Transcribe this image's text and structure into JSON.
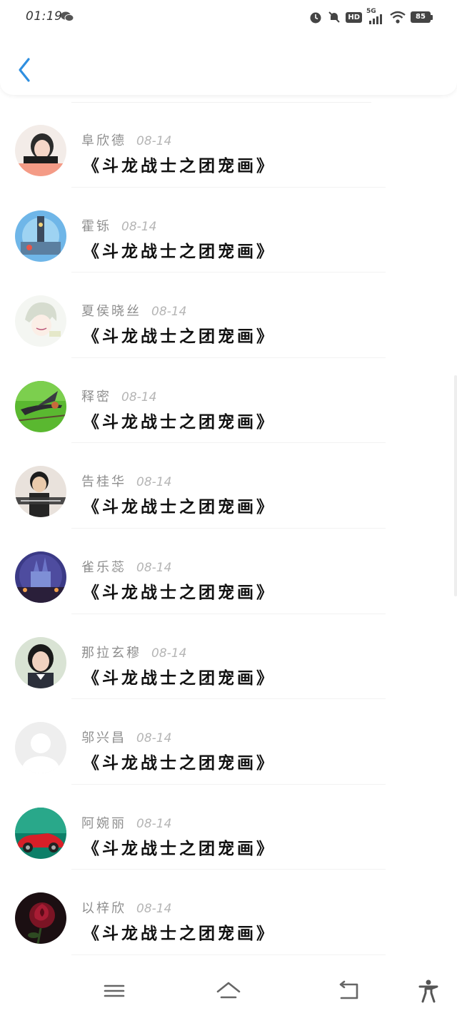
{
  "status_bar": {
    "time": "01:19",
    "battery": "85",
    "network": "5G",
    "hd": "HD"
  },
  "header": {
    "back_icon": "chevron-left-icon",
    "accent_color": "#2f8fe0"
  },
  "comments": [
    {
      "name": "阜欣德",
      "date": "08-14",
      "title": "《斗龙战士之团宠画》",
      "avatar_icon": "girl-photo-avatar"
    },
    {
      "name": "霍铄",
      "date": "08-14",
      "title": "《斗龙战士之团宠画》",
      "avatar_icon": "clocktower-avatar"
    },
    {
      "name": "夏侯晓丝",
      "date": "08-14",
      "title": "《斗龙战士之团宠画》",
      "avatar_icon": "anime-boy-avatar"
    },
    {
      "name": "释密",
      "date": "08-14",
      "title": "《斗龙战士之团宠画》",
      "avatar_icon": "swallow-bird-avatar"
    },
    {
      "name": "告桂华",
      "date": "08-14",
      "title": "《斗龙战士之团宠画》",
      "avatar_icon": "boy-photo-avatar"
    },
    {
      "name": "雀乐蕊",
      "date": "08-14",
      "title": "《斗龙战士之团宠画》",
      "avatar_icon": "castle-night-avatar"
    },
    {
      "name": "那拉玄穆",
      "date": "08-14",
      "title": "《斗龙战士之团宠画》",
      "avatar_icon": "girl-portrait-avatar"
    },
    {
      "name": "邬兴昌",
      "date": "08-14",
      "title": "《斗龙战士之团宠画》",
      "avatar_icon": "default-person-avatar"
    },
    {
      "name": "阿婉丽",
      "date": "08-14",
      "title": "《斗龙战士之团宠画》",
      "avatar_icon": "red-car-avatar"
    },
    {
      "name": "以梓欣",
      "date": "08-14",
      "title": "《斗龙战士之团宠画》",
      "avatar_icon": "rose-avatar"
    }
  ],
  "nav_bar": {
    "menu_icon": "menu-icon",
    "home_icon": "home-icon",
    "back_icon": "back-icon",
    "accessibility_icon": "accessibility-icon"
  }
}
